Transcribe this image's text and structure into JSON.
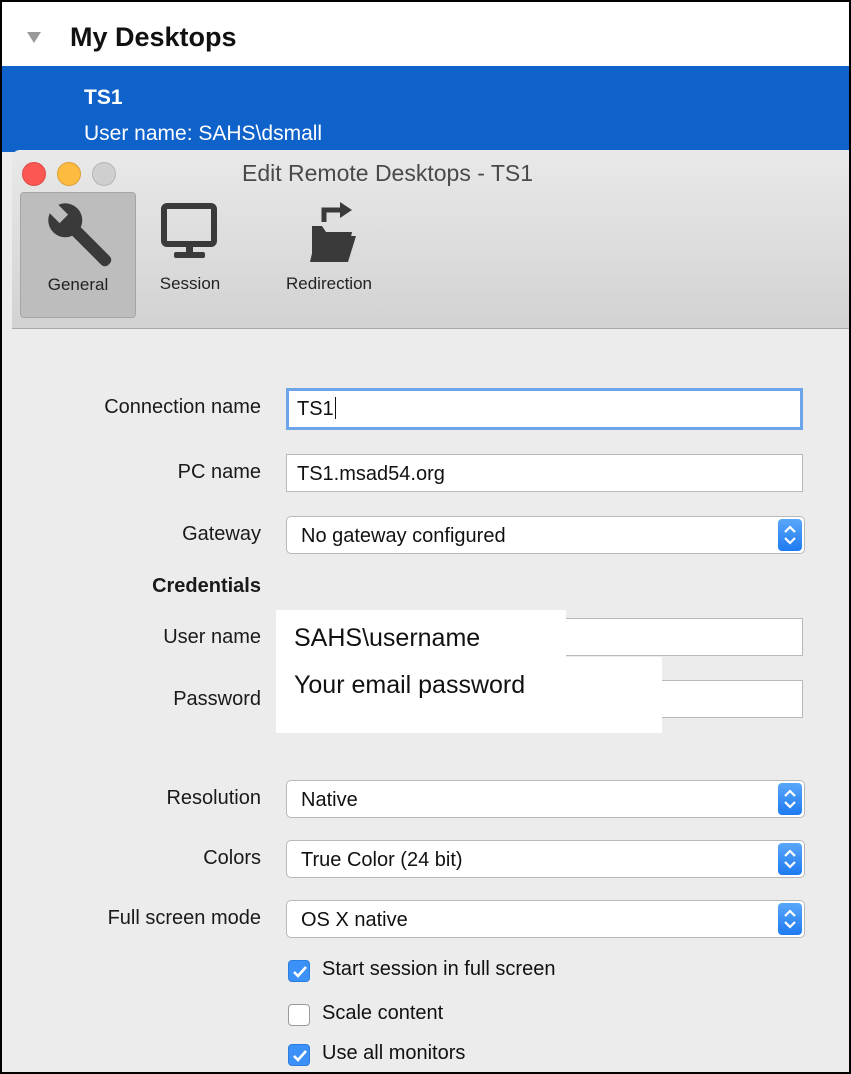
{
  "sidebar": {
    "section_title": "My Desktops",
    "selected": {
      "name": "TS1",
      "user": "User name: SAHS\\dsmall"
    }
  },
  "window": {
    "title": "Edit Remote Desktops - TS1",
    "tabs": [
      {
        "label": "General",
        "icon": "wrench-icon",
        "active": true
      },
      {
        "label": "Session",
        "icon": "monitor-icon",
        "active": false
      },
      {
        "label": "Redirection",
        "icon": "folder-redirect-icon",
        "active": false
      }
    ]
  },
  "form": {
    "connection_name": {
      "label": "Connection name",
      "value": "TS1"
    },
    "pc_name": {
      "label": "PC name",
      "value": "TS1.msad54.org"
    },
    "gateway": {
      "label": "Gateway",
      "value": "No gateway configured"
    },
    "credentials_heading": "Credentials",
    "user_name": {
      "label": "User name",
      "overlay": "SAHS\\username"
    },
    "password": {
      "label": "Password",
      "overlay": "Your email password"
    },
    "resolution": {
      "label": "Resolution",
      "value": "Native"
    },
    "colors": {
      "label": "Colors",
      "value": "True Color (24 bit)"
    },
    "full_screen_mode": {
      "label": "Full screen mode",
      "value": "OS X native"
    },
    "checkboxes": [
      {
        "label": "Start session in full screen",
        "checked": true
      },
      {
        "label": "Scale content",
        "checked": false
      },
      {
        "label": "Use all monitors",
        "checked": true
      }
    ]
  },
  "colors": {
    "selection_blue": "#0e62c9",
    "focus_ring": "#6ea5ea",
    "checkbox_blue": "#3b91f7",
    "close": "#fc5753",
    "minimize": "#fdbc40"
  }
}
